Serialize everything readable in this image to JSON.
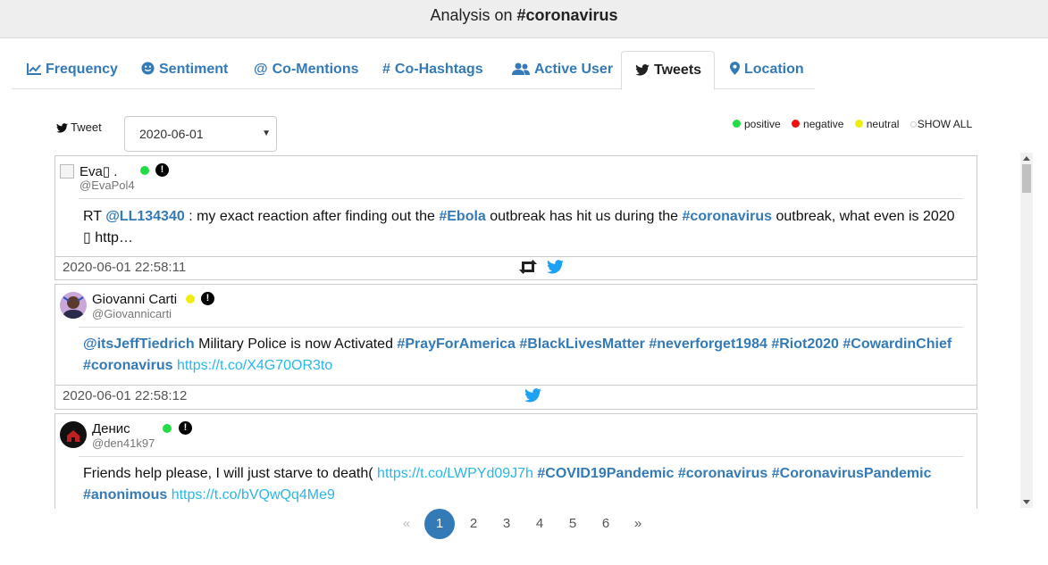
{
  "header": {
    "title_prefix": "Analysis on ",
    "title_topic": "#coronavirus"
  },
  "tabs": [
    {
      "label": "Frequency",
      "icon": "line-chart-icon"
    },
    {
      "label": "Sentiment",
      "icon": "smile-icon"
    },
    {
      "label": "Co-Mentions",
      "icon": "at-icon"
    },
    {
      "label": "Co-Hashtags",
      "icon": "hash-icon"
    },
    {
      "label": "Active User",
      "icon": "users-icon"
    },
    {
      "label": "Tweets",
      "icon": "twitter-icon",
      "active": true
    },
    {
      "label": "Location",
      "icon": "map-marker-icon"
    }
  ],
  "controls": {
    "label": "Tweet",
    "date_value": "2020-06-01"
  },
  "legend": {
    "positive": "positive",
    "negative": "negative",
    "neutral": "neutral",
    "show_all": "SHOW ALL"
  },
  "colors": {
    "positive": "#22dd44",
    "negative": "#ee1111",
    "neutral": "#eeee11",
    "accent": "#337ab7",
    "link": "#29b6e8"
  },
  "tweets": [
    {
      "name": "Eva▯ .",
      "handle": "@EvaPol4",
      "sentiment": "positive",
      "timestamp": "2020-06-01 22:58:11",
      "has_retweet": true
    },
    {
      "name": "Giovanni Carti",
      "handle": "@Giovannicarti",
      "sentiment": "neutral",
      "timestamp": "2020-06-01 22:58:12",
      "has_retweet": false
    },
    {
      "name": "Денис",
      "handle": "@den41k97",
      "sentiment": "positive",
      "timestamp": "",
      "has_retweet": false
    }
  ],
  "tweet_text": {
    "t1": {
      "p1": "RT ",
      "m1": "@LL134340",
      "p2": " : my exact reaction after finding out the ",
      "h1": "#Ebola",
      "p3": " outbreak has hit us during the ",
      "h2": "#coronavirus",
      "p4": " outbreak, what even is 2020 ",
      "p5": "▯ http…"
    },
    "t2": {
      "m1": "@itsJeffTiedrich",
      "p1": " Military Police is now Activated ",
      "h1": "#PrayForAmerica",
      "h2": "#BlackLivesMatter",
      "h3": "#neverforget1984",
      "h4": "#Riot2020",
      "h5": "#CowardinChief",
      "h6": "#coronavirus",
      "l1": "https://t.co/X4G70OR3to"
    },
    "t3": {
      "p1": "Friends help please, I will just starve to death( ",
      "l1": "https://t.co/LWPYd09J7h",
      "h1": "#COVID19Pandemic",
      "h2": "#coronavirus",
      "h3": "#CoronavirusPandemic",
      "h4": "#anonimous",
      "l2": "https://t.co/bVQwQq4Me9"
    }
  },
  "pagination": {
    "prev": "«",
    "pages": [
      "1",
      "2",
      "3",
      "4",
      "5",
      "6"
    ],
    "current": "1",
    "next": "»"
  }
}
